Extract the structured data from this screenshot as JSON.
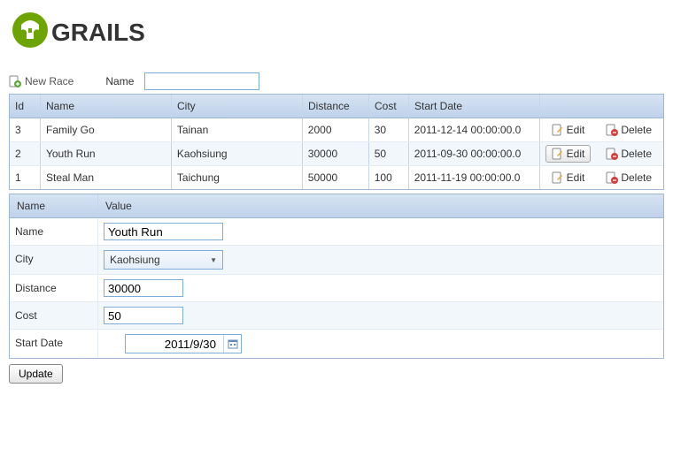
{
  "logo": {
    "text": "GRAILS"
  },
  "toolbar": {
    "newRaceLabel": "New Race",
    "nameLabel": "Name",
    "nameValue": ""
  },
  "grid": {
    "headers": {
      "id": "Id",
      "name": "Name",
      "city": "City",
      "distance": "Distance",
      "cost": "Cost",
      "startDate": "Start Date",
      "actions": ""
    },
    "actionLabels": {
      "edit": "Edit",
      "delete": "Delete"
    },
    "rows": [
      {
        "id": "3",
        "name": "Family Go",
        "city": "Tainan",
        "distance": "2000",
        "cost": "30",
        "startDate": "2011-12-14 00:00:00.0",
        "editActive": false
      },
      {
        "id": "2",
        "name": "Youth Run",
        "city": "Kaohsiung",
        "distance": "30000",
        "cost": "50",
        "startDate": "2011-09-30 00:00:00.0",
        "editActive": true
      },
      {
        "id": "1",
        "name": "Steal Man",
        "city": "Taichung",
        "distance": "50000",
        "cost": "100",
        "startDate": "2011-11-19 00:00:00.0",
        "editActive": false
      }
    ]
  },
  "form": {
    "headers": {
      "name": "Name",
      "value": "Value"
    },
    "fields": {
      "name": {
        "label": "Name",
        "value": "Youth Run"
      },
      "city": {
        "label": "City",
        "value": "Kaohsiung"
      },
      "distance": {
        "label": "Distance",
        "value": "30000"
      },
      "cost": {
        "label": "Cost",
        "value": "50"
      },
      "startDate": {
        "label": "Start Date",
        "value": "2011/9/30"
      }
    }
  },
  "updateLabel": "Update"
}
